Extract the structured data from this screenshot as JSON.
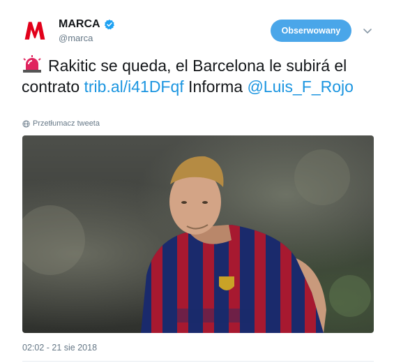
{
  "header": {
    "display_name": "MARCA",
    "handle": "@marca",
    "follow_label": "Obserwowany"
  },
  "tweet": {
    "text_part1": "Rakitic se queda, el Barcelona le subirá el contrato ",
    "link": "trib.al/i41DFqf",
    "text_part2": " Informa ",
    "mention": "@Luis_F_Rojo"
  },
  "translate_label": "Przetłumacz tweeta",
  "timestamp": "02:02 - 21 sie 2018",
  "colors": {
    "brand_red": "#e2001a",
    "link_blue": "#1b95e0",
    "follow_button": "#4aa6e9",
    "muted_text": "#657786"
  },
  "icons": [
    "marca-logo",
    "verified-badge-icon",
    "chevron-down-icon",
    "siren-emoji-icon",
    "globe-icon"
  ]
}
